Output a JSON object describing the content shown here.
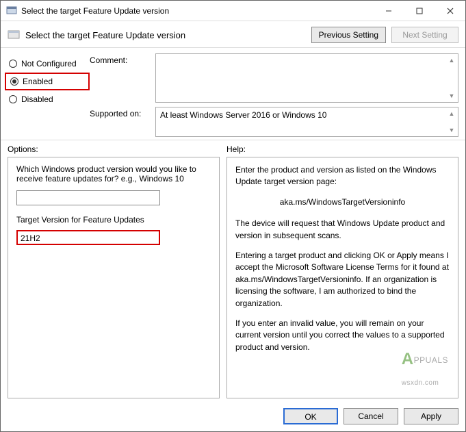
{
  "window": {
    "title": "Select the target Feature Update version"
  },
  "header": {
    "title": "Select the target Feature Update version",
    "prev_label": "Previous Setting",
    "next_label": "Next Setting"
  },
  "state": {
    "not_configured": "Not Configured",
    "enabled": "Enabled",
    "disabled": "Disabled",
    "selected": "enabled"
  },
  "fields": {
    "comment_label": "Comment:",
    "comment_value": "",
    "supported_label": "Supported on:",
    "supported_value": "At least Windows Server 2016 or Windows 10"
  },
  "labels": {
    "options": "Options:",
    "help": "Help:"
  },
  "options": {
    "question": "Which Windows product version would you like to receive feature updates for? e.g., Windows 10",
    "product_value": "",
    "target_label": "Target Version for Feature Updates",
    "target_value": "21H2"
  },
  "help": {
    "p1": "Enter the product and version as listed on the Windows Update target version page:",
    "link": "aka.ms/WindowsTargetVersioninfo",
    "p2": "The device will request that Windows Update product and version in subsequent scans.",
    "p3": "Entering a target product and clicking OK or Apply means I accept the Microsoft Software License Terms for it found at aka.ms/WindowsTargetVersioninfo. If an organization is licensing the software, I am authorized to bind the organization.",
    "p4": "If you enter an invalid value, you will remain on your current version until you correct the values to a supported product and version."
  },
  "buttons": {
    "ok": "OK",
    "cancel": "Cancel",
    "apply": "Apply"
  },
  "watermark": {
    "brand": "PPUALS",
    "site": "wsxdn.com"
  }
}
